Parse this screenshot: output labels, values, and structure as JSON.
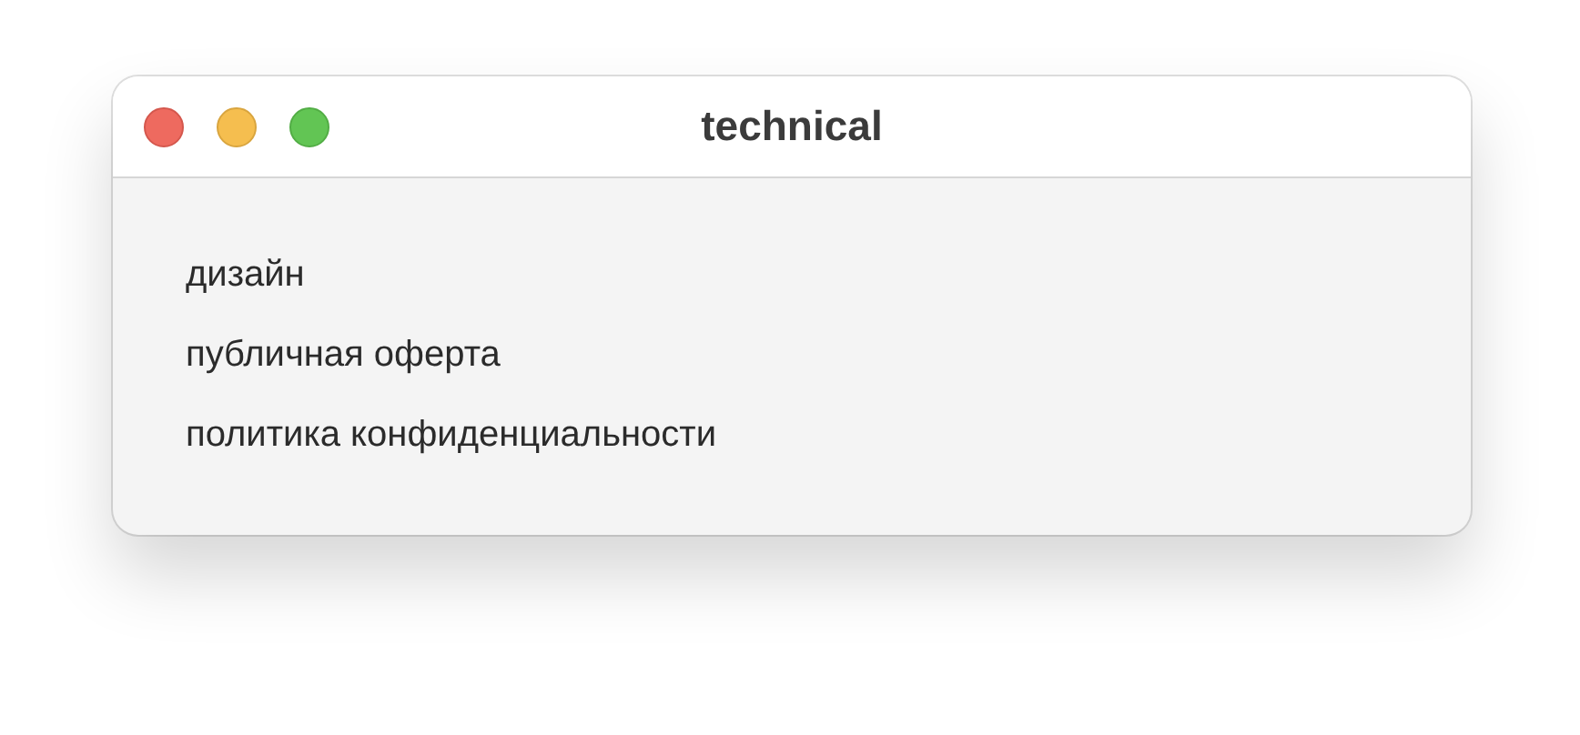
{
  "window": {
    "title": "technical"
  },
  "items": [
    {
      "label": "дизайн"
    },
    {
      "label": "публичная оферта"
    },
    {
      "label": "политика конфиденциальности"
    }
  ]
}
